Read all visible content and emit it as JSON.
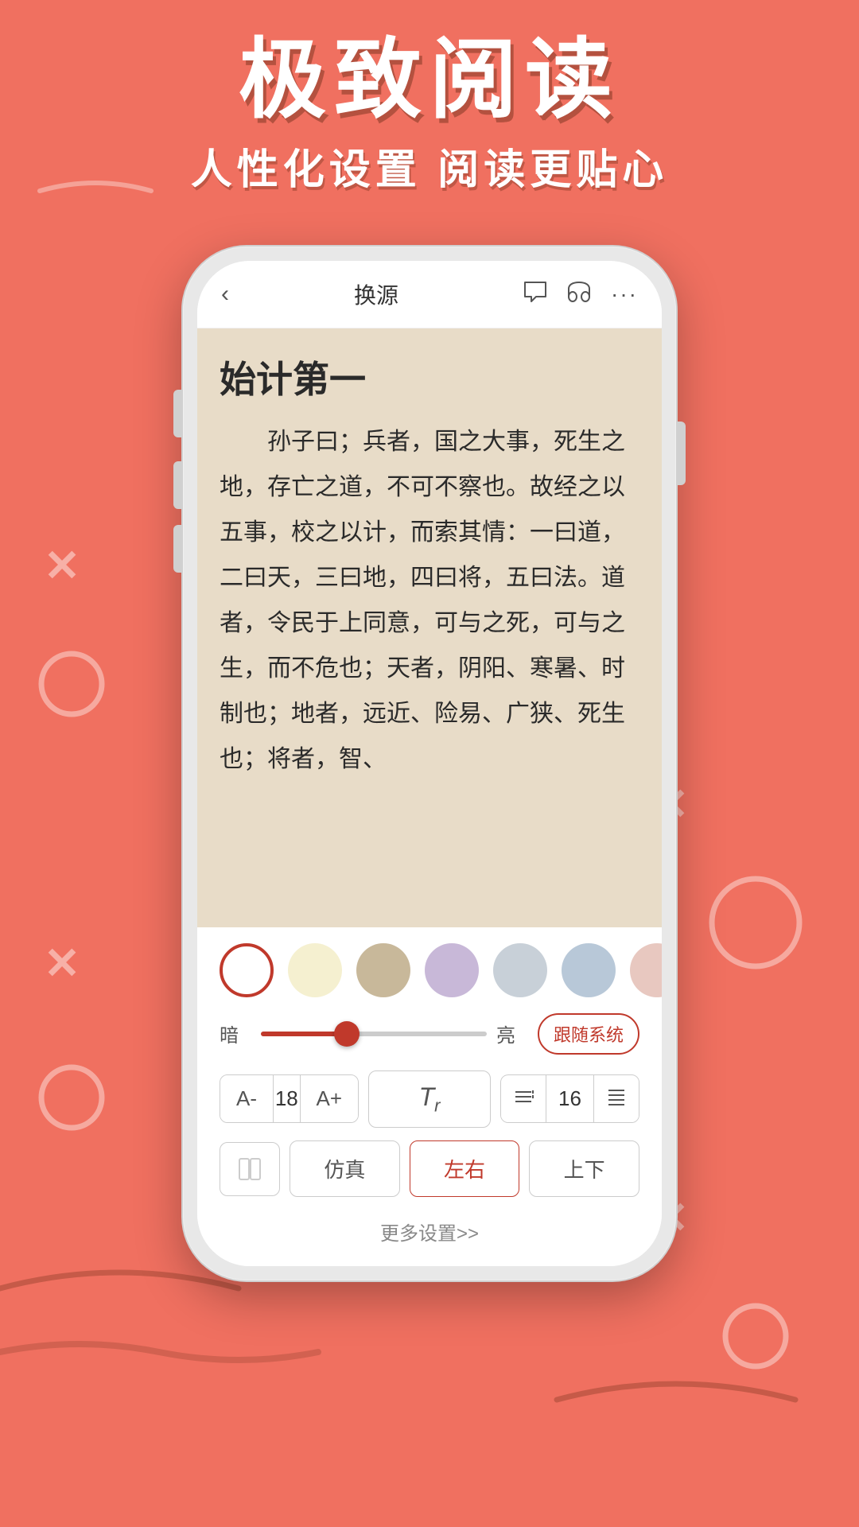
{
  "background": {
    "color": "#F07060"
  },
  "title": {
    "main": "极致阅读",
    "sub": "人性化设置  阅读更贴心"
  },
  "phone": {
    "topbar": {
      "back_icon": "‹",
      "title": "换源",
      "comment_icon": "💬",
      "audio_icon": "🎧",
      "more_icon": "···"
    },
    "reading": {
      "chapter_title": "始计第一",
      "content": "孙子曰；兵者，国之大事，死生之地，存亡之道，不可不察也。故经之以五事，校之以计，而索其情：一曰道，二曰天，三曰地，四曰将，五曰法。道者，令民于上同意，可与之死，可与之生，而不危也；天者，阴阳、寒暑、时制也；地者，远近、险易、广狭、死生也；将者，智、"
    },
    "settings": {
      "colors": [
        {
          "value": "#FFFFFF",
          "selected": true
        },
        {
          "value": "#F5F0D0",
          "selected": false
        },
        {
          "value": "#C8B89A",
          "selected": false
        },
        {
          "value": "#C8B8D8",
          "selected": false
        },
        {
          "value": "#C8D0D8",
          "selected": false
        },
        {
          "value": "#B8C8D8",
          "selected": false
        },
        {
          "value": "#E8C8C0",
          "selected": false
        }
      ],
      "brightness": {
        "dark_label": "暗",
        "bright_label": "亮",
        "value": 38,
        "follow_system": "跟随系统"
      },
      "font": {
        "decrease": "A-",
        "size": "18",
        "increase": "A+",
        "style_label": "Tr",
        "line_decrease": "÷",
        "line_size": "16",
        "line_increase": "≡"
      },
      "page_modes": [
        {
          "label": "仿真",
          "active": false
        },
        {
          "label": "左右",
          "active": true
        },
        {
          "label": "上下",
          "active": false
        }
      ],
      "more_settings": "更多设置>>"
    }
  }
}
